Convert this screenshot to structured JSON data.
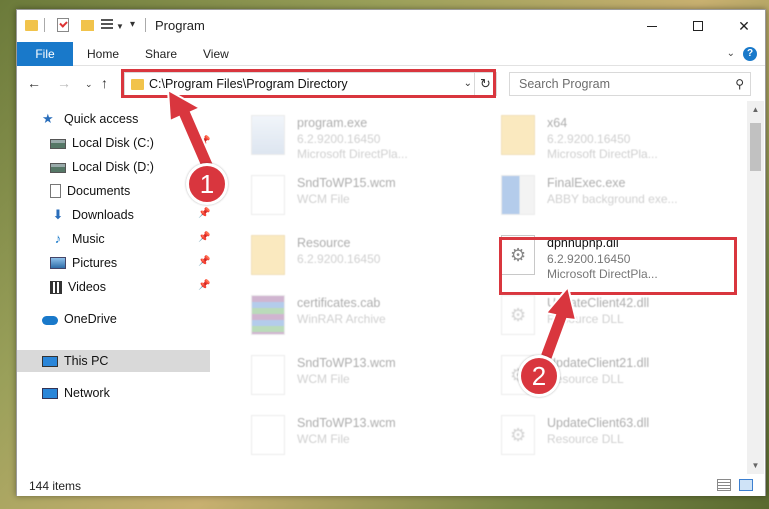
{
  "window": {
    "title": "Program",
    "quick_access_toolbar": [
      "folder-icon",
      "properties-check-icon",
      "new-folder-icon",
      "properties-icon"
    ]
  },
  "ribbon": {
    "tabs": [
      {
        "label": "File"
      },
      {
        "label": "Home"
      },
      {
        "label": "Share"
      },
      {
        "label": "View"
      }
    ],
    "help": "?"
  },
  "address": {
    "path": "C:\\Program Files\\Program Directory"
  },
  "search": {
    "placeholder": "Search Program"
  },
  "sidebar": {
    "items": [
      {
        "label": "Quick access",
        "icon": "star-icon",
        "pinned": false
      },
      {
        "label": "Local Disk (C:)",
        "icon": "disk-icon",
        "pinned": true
      },
      {
        "label": "Local Disk (D:)",
        "icon": "disk-icon",
        "pinned": false
      },
      {
        "label": "Documents",
        "icon": "document-icon",
        "pinned": true
      },
      {
        "label": "Downloads",
        "icon": "download-icon",
        "pinned": true
      },
      {
        "label": "Music",
        "icon": "music-icon",
        "pinned": true
      },
      {
        "label": "Pictures",
        "icon": "pictures-icon",
        "pinned": true
      },
      {
        "label": "Videos",
        "icon": "videos-icon",
        "pinned": true
      },
      {
        "label": "OneDrive",
        "icon": "cloud-icon",
        "pinned": false
      },
      {
        "label": "This PC",
        "icon": "computer-icon",
        "pinned": false,
        "selected": true
      },
      {
        "label": "Network",
        "icon": "network-icon",
        "pinned": false
      }
    ]
  },
  "files": [
    {
      "name": "program.exe",
      "line2": "6.2.9200.16450",
      "line3": "Microsoft DirectPla...",
      "icon": "exe"
    },
    {
      "name": "x64",
      "line2": "6.2.9200.16450",
      "line3": "Microsoft DirectPla...",
      "icon": "folder"
    },
    {
      "name": "SndToWP15.wcm",
      "line2": "WCM File",
      "line3": "",
      "icon": "doc"
    },
    {
      "name": "FinalExec.exe",
      "line2": "ABBY background exe...",
      "line3": "",
      "icon": "win"
    },
    {
      "name": "Resource",
      "line2": "6.2.9200.16450",
      "line3": "",
      "icon": "folder"
    },
    {
      "name": "dpnhupnp.dll",
      "line2": "6.2.9200.16450",
      "line3": "Microsoft DirectPla...",
      "icon": "gear",
      "highlighted": true
    },
    {
      "name": "certificates.cab",
      "line2": "WinRAR Archive",
      "line3": "",
      "icon": "rar"
    },
    {
      "name": "UpdateClient42.dll",
      "line2": "Resource DLL",
      "line3": "",
      "icon": "gear"
    },
    {
      "name": "SndToWP13.wcm",
      "line2": "WCM File",
      "line3": "",
      "icon": "doc"
    },
    {
      "name": "UpdateClient21.dll",
      "line2": "Resource DLL",
      "line3": "",
      "icon": "gear"
    },
    {
      "name": "SndToWP13.wcm",
      "line2": "WCM File",
      "line3": "",
      "icon": "doc"
    },
    {
      "name": "UpdateClient63.dll",
      "line2": "Resource DLL",
      "line3": "",
      "icon": "gear"
    }
  ],
  "status": {
    "item_count": "144 items"
  },
  "annotations": [
    {
      "label": "1"
    },
    {
      "label": "2"
    }
  ]
}
